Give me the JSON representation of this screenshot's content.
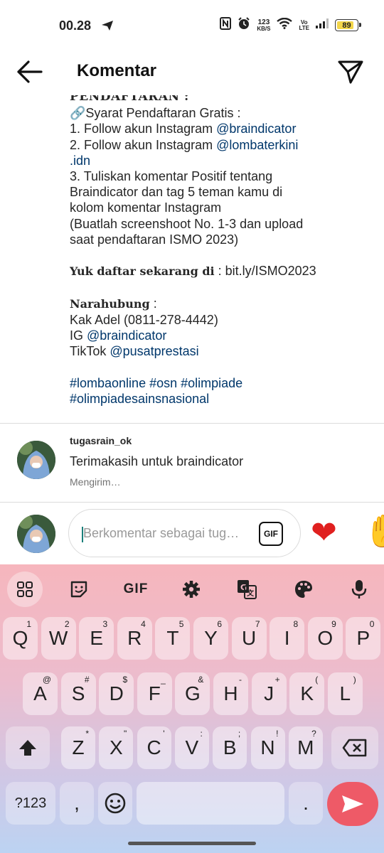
{
  "status_bar": {
    "time": "00.28",
    "net_speed_value": "123",
    "net_speed_unit": "KB/S",
    "volte": "Vo",
    "lte": "LTE",
    "battery": "89",
    "icons": [
      "telegram-send-icon",
      "nfc-icon",
      "alarm-icon",
      "wifi-icon",
      "signal-icon",
      "battery-icon"
    ]
  },
  "header": {
    "title": "Komentar",
    "back_icon": "arrow-left-icon",
    "share_icon": "paper-plane-icon"
  },
  "caption": {
    "cut_heading": "PENDAFTARAN :",
    "requirements_title": "Syarat Pendaftaran Gratis :",
    "item1_text": "1. Follow akun Instagram ",
    "item1_link": "@braindicator",
    "item2_text": "2. Follow akun Instagram ",
    "item2_link_a": "@lombaterkini",
    "item2_link_b": ".idn",
    "item3_l1": "3. Tuliskan komentar Positif tentang",
    "item3_l2": "Braindicator dan tag 5 teman kamu di",
    "item3_l3": "kolom komentar Instagram",
    "note_l1": "(Buatlah screenshoot No. 1-3 dan upload",
    "note_l2": "saat pendaftaran ISMO 2023)",
    "register_label": "Yuk daftar sekarang di",
    "register_link": " : bit.ly/ISMO2023",
    "contact_label": "Narahubung",
    "contact_colon": " :",
    "contact_person": "Kak Adel (0811-278-4442)",
    "ig_label": "IG ",
    "ig_link": "@braindicator",
    "tiktok_label": "TikTok ",
    "tiktok_link": "@pusatprestasi",
    "hashtags_l1": "#lombaonline #osn #olimpiade",
    "hashtags_l2": "#olimpiadesainsnasional"
  },
  "comment": {
    "username": "tugasrain_ok",
    "text": "Terimakasih untuk braindicator",
    "status": "Mengirim…"
  },
  "composer": {
    "placeholder": "Berkomentar sebagai tug…",
    "gif_label": "GIF",
    "quick_reactions": [
      "❤",
      "✋"
    ]
  },
  "keyboard": {
    "toolbar": [
      "apps-grid-icon",
      "sticker-icon",
      "GIF",
      "settings-gear-icon",
      "translate-icon",
      "palette-icon",
      "microphone-icon"
    ],
    "toolbar_gif": "GIF",
    "row1": [
      {
        "k": "Q",
        "h": "1"
      },
      {
        "k": "W",
        "h": "2"
      },
      {
        "k": "E",
        "h": "3"
      },
      {
        "k": "R",
        "h": "4"
      },
      {
        "k": "T",
        "h": "5"
      },
      {
        "k": "Y",
        "h": "6"
      },
      {
        "k": "U",
        "h": "7"
      },
      {
        "k": "I",
        "h": "8"
      },
      {
        "k": "O",
        "h": "9"
      },
      {
        "k": "P",
        "h": "0"
      }
    ],
    "row2": [
      {
        "k": "A",
        "h": "@"
      },
      {
        "k": "S",
        "h": "#"
      },
      {
        "k": "D",
        "h": "$"
      },
      {
        "k": "F",
        "h": "_"
      },
      {
        "k": "G",
        "h": "&"
      },
      {
        "k": "H",
        "h": "-"
      },
      {
        "k": "J",
        "h": "+"
      },
      {
        "k": "K",
        "h": "("
      },
      {
        "k": "L",
        "h": ")"
      }
    ],
    "row3": [
      {
        "k": "Z",
        "h": "*"
      },
      {
        "k": "X",
        "h": "\""
      },
      {
        "k": "C",
        "h": "'"
      },
      {
        "k": "V",
        "h": ":"
      },
      {
        "k": "B",
        "h": ";"
      },
      {
        "k": "N",
        "h": "!"
      },
      {
        "k": "M",
        "h": "?"
      }
    ],
    "symbols_key": "?123",
    "comma_key": ",",
    "period_key": ".",
    "shift_icon": "shift-arrow-icon",
    "backspace_icon": "backspace-icon",
    "emoji_icon": "smiley-icon",
    "enter_icon": "send-arrow-icon"
  }
}
